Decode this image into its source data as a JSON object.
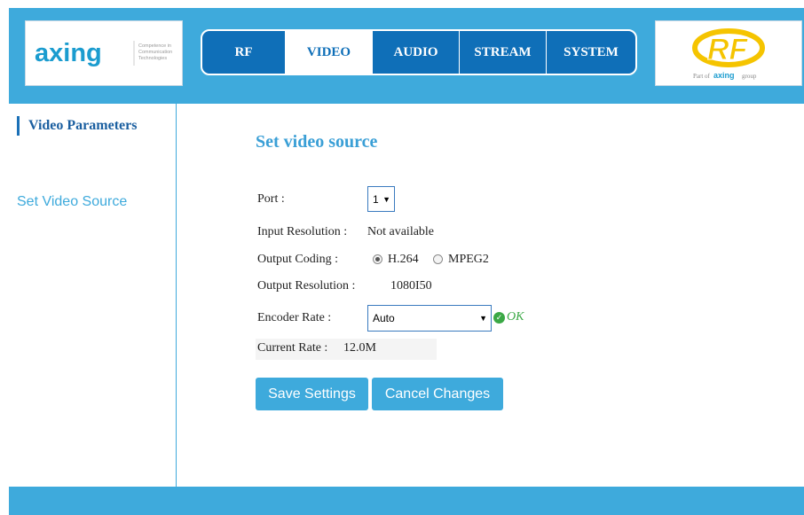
{
  "brand": {
    "left_logo_text": "axing",
    "left_logo_tagline": "Competence in Communication Technologies",
    "right_logo_text": "RF",
    "right_logo_tagline": "Part of axing group"
  },
  "nav": {
    "tabs": [
      {
        "label": "RF",
        "active": false
      },
      {
        "label": "VIDEO",
        "active": true
      },
      {
        "label": "AUDIO",
        "active": false
      },
      {
        "label": "STREAM",
        "active": false
      },
      {
        "label": "SYSTEM",
        "active": false
      }
    ]
  },
  "sidebar": {
    "section_title": "Video Parameters",
    "links": [
      {
        "label": "Set Video Source"
      }
    ]
  },
  "main": {
    "title": "Set video source",
    "port": {
      "label": "Port :",
      "value": "1"
    },
    "input_resolution": {
      "label": "Input Resolution :",
      "value": "Not available"
    },
    "output_coding": {
      "label": "Output Coding :",
      "options": [
        {
          "label": "H.264",
          "checked": true
        },
        {
          "label": "MPEG2",
          "checked": false
        }
      ]
    },
    "output_resolution": {
      "label": "Output  Resolution :",
      "value": "1080I50"
    },
    "encoder_rate": {
      "label": "Encoder Rate :",
      "value": "Auto",
      "status": "OK"
    },
    "current_rate": {
      "label": "Current Rate :",
      "value": "12.0M"
    },
    "buttons": {
      "save": "Save Settings",
      "cancel": "Cancel Changes"
    }
  },
  "colors": {
    "accent": "#3eaadc",
    "nav_blue": "#0f6fb8",
    "ok_green": "#3aa845"
  }
}
